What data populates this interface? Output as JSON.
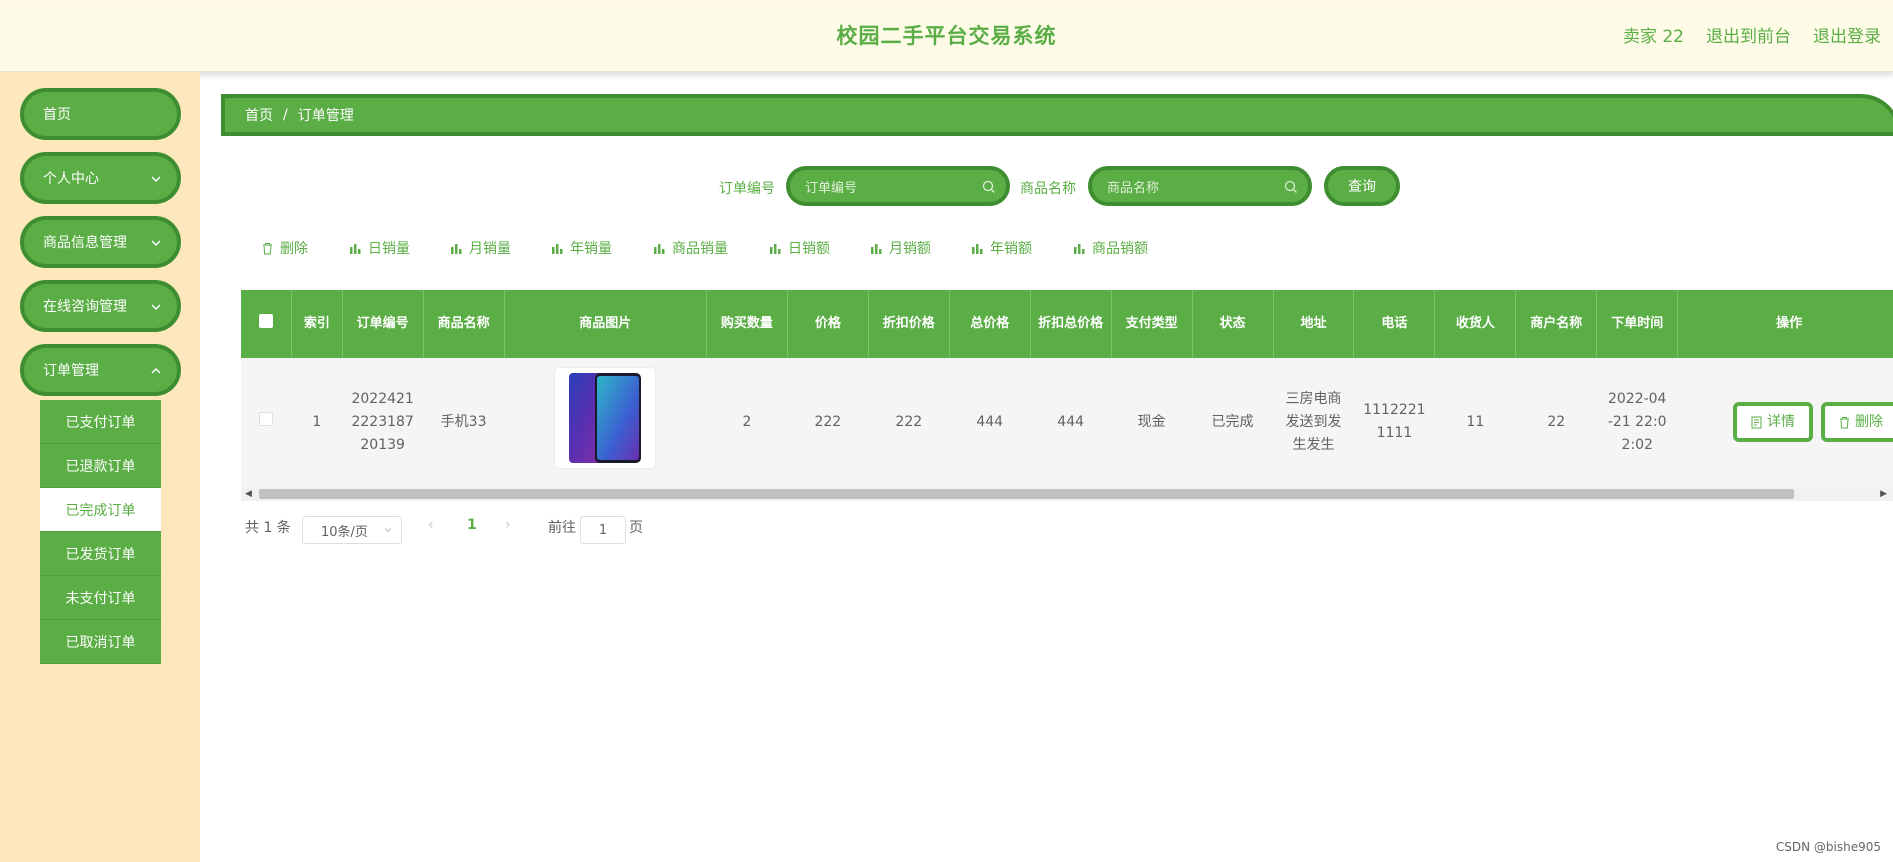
{
  "header": {
    "title": "校园二手平台交易系统",
    "user": "卖家 22",
    "back_to_front": "退出到前台",
    "logout": "退出登录"
  },
  "sidebar": {
    "items": [
      {
        "label": "首页",
        "has_arrow": false
      },
      {
        "label": "个人中心",
        "has_arrow": true
      },
      {
        "label": "商品信息管理",
        "has_arrow": true
      },
      {
        "label": "在线咨询管理",
        "has_arrow": true
      },
      {
        "label": "订单管理",
        "has_arrow": true
      }
    ],
    "submenu": [
      {
        "label": "已支付订单",
        "active": false
      },
      {
        "label": "已退款订单",
        "active": false
      },
      {
        "label": "已完成订单",
        "active": true
      },
      {
        "label": "已发货订单",
        "active": false
      },
      {
        "label": "未支付订单",
        "active": false
      },
      {
        "label": "已取消订单",
        "active": false
      }
    ]
  },
  "breadcrumb": {
    "home": "首页",
    "separator": "/",
    "current": "订单管理"
  },
  "search": {
    "order_no_label": "订单编号",
    "order_no_placeholder": "订单编号",
    "product_name_label": "商品名称",
    "product_name_placeholder": "商品名称",
    "query_button": "查询"
  },
  "toolbar": {
    "delete": "删除",
    "daily_sales_qty": "日销量",
    "monthly_sales_qty": "月销量",
    "yearly_sales_qty": "年销量",
    "product_sales_qty": "商品销量",
    "daily_sales_amt": "日销额",
    "monthly_sales_amt": "月销额",
    "yearly_sales_amt": "年销额",
    "product_sales_amt": "商品销额"
  },
  "table": {
    "columns": [
      "索引",
      "订单编号",
      "商品名称",
      "商品图片",
      "购买数量",
      "价格",
      "折扣价格",
      "总价格",
      "折扣总价格",
      "支付类型",
      "状态",
      "地址",
      "电话",
      "收货人",
      "商户名称",
      "下单时间",
      "操作"
    ],
    "rows": [
      {
        "index": "1",
        "order_no": "202242122231872 0139",
        "order_no_lines": [
          "2022421",
          "2223187",
          "20139"
        ],
        "product_name": "手机33",
        "quantity": "2",
        "price": "222",
        "discount_price": "222",
        "total_price": "444",
        "discount_total": "444",
        "pay_type": "现金",
        "status": "已完成",
        "address_lines": [
          "三房电商",
          "发送到发",
          "生发生"
        ],
        "phone_lines": [
          "1112221",
          "1111"
        ],
        "receiver": "11",
        "merchant": "22",
        "order_time_lines": [
          "2022-04",
          "-21 22:0",
          "2:02"
        ],
        "detail_button": "详情",
        "delete_button": "删除"
      }
    ]
  },
  "pagination": {
    "total": "共 1 条",
    "page_size": "10条/页",
    "current_page": "1",
    "goto_label": "前往",
    "goto_value": "1",
    "page_suffix": "页"
  },
  "watermark": "CSDN @bishe905",
  "colors": {
    "primary": "#5aae45",
    "primary_dark": "#3e8e31",
    "sidebar_bg": "#fde8bd",
    "header_bg": "#fffbe6"
  }
}
